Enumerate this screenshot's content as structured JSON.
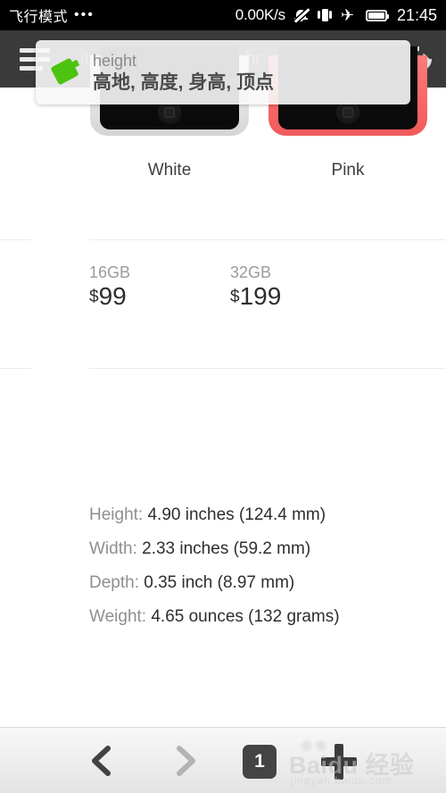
{
  "statusbar": {
    "carrier": "飞行模式",
    "dots": "•••",
    "network_speed": "0.00K/s",
    "time": "21:45",
    "icons": [
      "silent-bell-icon",
      "vibrate-icon",
      "airplane-mode-icon",
      "battery-icon"
    ]
  },
  "browser": {
    "menu_icon": "hamburger-menu-icon",
    "page_title": "ite – iPhone 5c – Techr",
    "book_icon": "open-book-icon",
    "reload_icon": "reload-icon"
  },
  "dictionary_popup": {
    "tag_icon": "green-tag-icon",
    "word": "height",
    "translation": "高地, 高度, 身高, 顶点"
  },
  "page": {
    "phones": [
      {
        "color_name": "White",
        "swatch": "#e9e9e9"
      },
      {
        "color_name": "Pink",
        "swatch": "#f96868"
      }
    ],
    "prices": [
      {
        "capacity": "16GB",
        "currency": "$",
        "amount": "99"
      },
      {
        "capacity": "32GB",
        "currency": "$",
        "amount": "199"
      }
    ],
    "specs": [
      {
        "label": "Height:",
        "value": "4.90 inches (124.4 mm)"
      },
      {
        "label": "Width:",
        "value": "2.33 inches (59.2 mm)"
      },
      {
        "label": "Depth:",
        "value": "0.35 inch (8.97 mm)"
      },
      {
        "label": "Weight:",
        "value": "4.65 ounces (132 grams)"
      }
    ]
  },
  "bottombar": {
    "back_icon": "chevron-left-icon",
    "forward_icon": "chevron-right-icon",
    "tab_count": "1",
    "add_icon": "plus-icon"
  },
  "watermark": {
    "brand": "Baidu 经验",
    "url": "jingyan.baidu.com"
  },
  "colors": {
    "accent_green": "#4dc311",
    "topbar": "#3a3a3a",
    "pink_phone": "#f96868"
  }
}
